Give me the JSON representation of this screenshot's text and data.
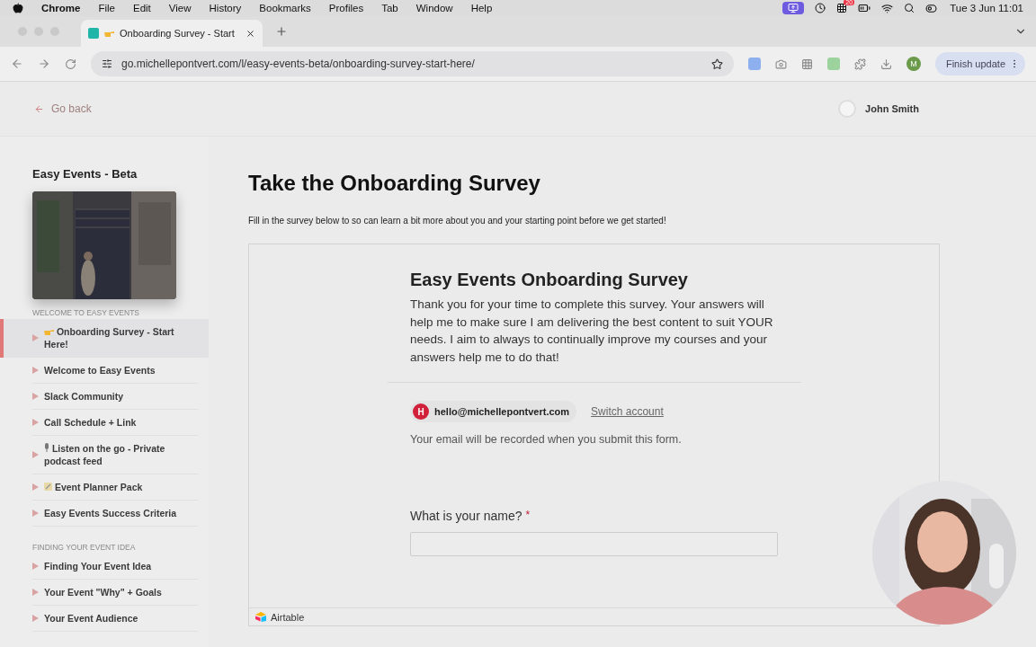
{
  "menu_bar": {
    "app": "Chrome",
    "menus": [
      "File",
      "Edit",
      "View",
      "History",
      "Bookmarks",
      "Profiles",
      "Tab",
      "Window",
      "Help"
    ],
    "calendar_badge": "20",
    "clock": "Tue 3 Jun 11:01"
  },
  "browser": {
    "tabs": [
      {
        "title": "Onboarding Survey - Start",
        "selected": true
      }
    ],
    "url": "go.michellepontvert.com/l/easy-events-beta/onboarding-survey-start-here/",
    "profile_initial": "M",
    "update_button": "Finish update"
  },
  "page": {
    "back_link": "Go back",
    "user_name": "John Smith"
  },
  "sidebar": {
    "course_title": "Easy Events - Beta",
    "sections": [
      {
        "heading": "WELCOME TO EASY EVENTS",
        "lessons": [
          {
            "title": "Onboarding Survey - Start Here!",
            "kind": "hand",
            "selected": true
          },
          {
            "title": "Welcome to Easy Events",
            "kind": "plain",
            "selected": false
          },
          {
            "title": "Slack Community",
            "kind": "plain",
            "selected": false
          },
          {
            "title": "Call Schedule + Link",
            "kind": "plain",
            "selected": false
          },
          {
            "title": "Listen on the go - Private podcast feed",
            "kind": "mic",
            "selected": false
          },
          {
            "title": "Event Planner Pack",
            "kind": "note",
            "selected": false
          },
          {
            "title": "Easy Events Success Criteria",
            "kind": "plain",
            "selected": false
          }
        ]
      },
      {
        "heading": "FINDING YOUR EVENT IDEA",
        "lessons": [
          {
            "title": "Finding Your Event Idea",
            "kind": "plain",
            "selected": false
          },
          {
            "title": "Your Event \"Why\" + Goals",
            "kind": "plain",
            "selected": false
          },
          {
            "title": "Your Event Audience",
            "kind": "plain",
            "selected": false
          }
        ]
      }
    ]
  },
  "content": {
    "heading": "Take the Onboarding Survey",
    "intro": "Fill in the survey below to so can learn a bit more about you and your starting point before we get started!",
    "form": {
      "title": "Easy Events Onboarding Survey",
      "description": "Thank you for your time to complete this survey. Your answers will help me to make sure I am delivering the best content to suit YOUR needs. I aim to always to continually improve my courses and your answers help me to do that!",
      "account_initial": "H",
      "email": "hello@michellepontvert.com",
      "switch_account": "Switch account",
      "email_note": "Your email will be recorded when you submit this form.",
      "questions": [
        {
          "label": "What is your name?",
          "required_mark": "*"
        }
      ],
      "footer_brand": "Airtable"
    }
  }
}
